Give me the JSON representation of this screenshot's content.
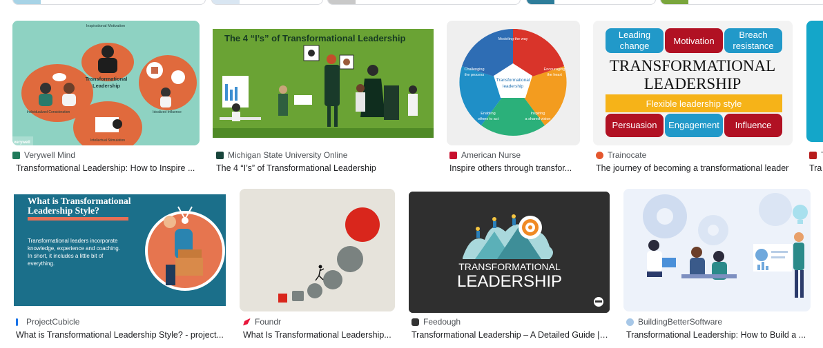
{
  "results": [
    {
      "source": "Verywell Mind",
      "title": "Transformational Leadership: How to Inspire ...",
      "fav_color": "#1f7a5a"
    },
    {
      "source": "Michigan State University Online",
      "title": "The 4 “I’s” of Transformational Leadership",
      "fav_color": "#18453b"
    },
    {
      "source": "American Nurse",
      "title": "Inspire others through transfor...",
      "fav_color": "#c8102e"
    },
    {
      "source": "Trainocate",
      "title": "The journey of becoming a transformational leader",
      "fav_color": "#e4572e"
    },
    {
      "source": "T",
      "title": "Tra",
      "fav_color": "#b71c1c"
    },
    {
      "source": "ProjectCubicle",
      "title": "What is Transformational Leadership Style? - project...",
      "fav_color": "#1a73e8"
    },
    {
      "source": "Foundr",
      "title": "What Is Transformational Leadership...",
      "fav_color": "#e8163b"
    },
    {
      "source": "Feedough",
      "title": "Transformational Leadership – A Detailed Guide | ...",
      "fav_color": "#333333"
    },
    {
      "source": "BuildingBetterSoftware",
      "title": "Transformational Leadership: How to Build a ...",
      "fav_color": "#6fa8dc"
    }
  ],
  "verywell": {
    "top": "Inspirational Motivation",
    "center_1": "Transformational",
    "center_2": "Leadership",
    "left": "Individualized Consideration",
    "right": "Idealized Influence",
    "bottom": "Intellectual Stimulation",
    "logo": "verywell"
  },
  "msu": {
    "heading": "The 4 “I’s” of Transformational Leadership"
  },
  "nurse": {
    "top": "Modeling the way",
    "left_1": "Challenging",
    "left_2": "the process",
    "right_1": "Encouraging",
    "right_2": "the heart",
    "bl_1": "Enabling",
    "bl_2": "others to act",
    "br_1": "Inspiring",
    "br_2": "a shared vision",
    "center_1": "Transformational",
    "center_2": "leadership"
  },
  "trainocate": {
    "b1_1": "Leading",
    "b1_2": "change",
    "b2": "Motivation",
    "b3_1": "Breach",
    "b3_2": "resistance",
    "title_1": "TRANSFORMATIONAL",
    "title_2": "LEADERSHIP",
    "bar": "Flexible leadership style",
    "c1": "Persuasion",
    "c2": "Engagement",
    "c3": "Influence"
  },
  "cubicle": {
    "heading_1": "What is Transformational",
    "heading_2": "Leadership Style?",
    "p1": "Transformational leaders incorporate",
    "p2": "knowledge, experience and coaching.",
    "p3": "In short, it includes a little bit of",
    "p4": "everything."
  },
  "feedough": {
    "line1": "TRANSFORMATIONAL",
    "line2": "LEADERSHIP"
  },
  "colors": {
    "source": "#4d5156",
    "title": "#202124",
    "border": "#dadce0"
  }
}
